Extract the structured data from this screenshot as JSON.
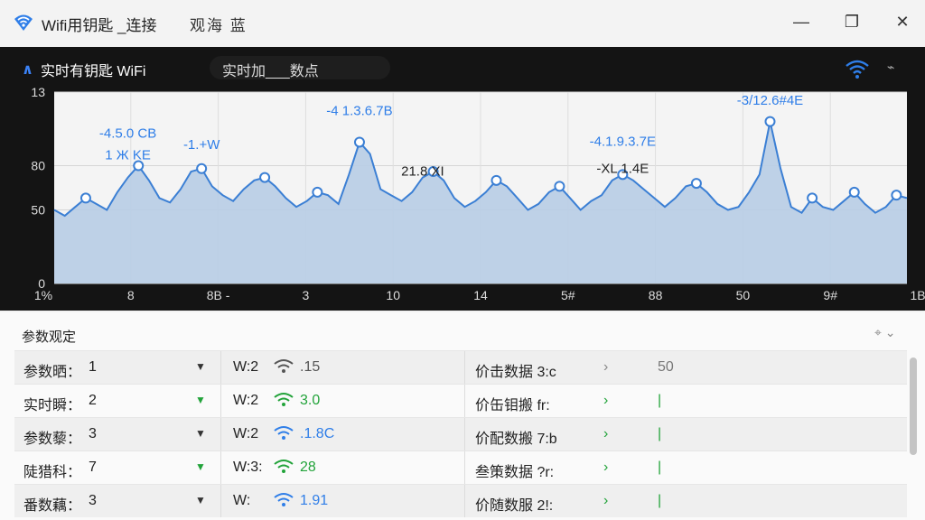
{
  "window": {
    "title": "Wifi用钥匙 _连接",
    "subtitle": "观海 蓝",
    "min_label": "—",
    "max_label": "❐",
    "close_label": "✕"
  },
  "chart_header": {
    "title": "实时有钥匙  WiFi",
    "search_text": "实时加___数点",
    "accent": "#2f7ee8"
  },
  "chart_data": {
    "type": "area",
    "ylim": [
      0,
      130
    ],
    "y_ticks": [
      "0",
      "50",
      "80",
      "13"
    ],
    "x_ticks": [
      "1%",
      "8",
      "8B -",
      "3",
      "10",
      "14",
      "5#",
      "88",
      "50",
      "9#",
      "1B"
    ],
    "series": [
      {
        "values": [
          50,
          46,
          52,
          58,
          54,
          50,
          62,
          72,
          80,
          70,
          58,
          55,
          64,
          76,
          78,
          66,
          60,
          56,
          64,
          70,
          72,
          66,
          58,
          52,
          56,
          62,
          60,
          54,
          74,
          96,
          88,
          64,
          60,
          56,
          62,
          72,
          76,
          70,
          58,
          52,
          56,
          62,
          70,
          66,
          58,
          50,
          54,
          62,
          66,
          58,
          50,
          56,
          60,
          70,
          74,
          70,
          64,
          58,
          52,
          58,
          66,
          68,
          62,
          54,
          50,
          52,
          62,
          74,
          110,
          78,
          52,
          48,
          58,
          52,
          50,
          56,
          62,
          54,
          48,
          52,
          60,
          58
        ]
      }
    ],
    "annotations": [
      {
        "text": "-4.5.0 CB",
        "color": "#2f7ee8"
      },
      {
        "text": "1 Ж KE",
        "color": "#2f7ee8"
      },
      {
        "text": "-1.+W",
        "color": "#2f7ee8"
      },
      {
        "text": "-4 1.3.6.7B",
        "color": "#2f7ee8"
      },
      {
        "text": "21.8 XI",
        "color": "#222222"
      },
      {
        "text": "-4.1.9.3.7E",
        "color": "#2f7ee8"
      },
      {
        "text": "-XL 1.4E",
        "color": "#222222"
      },
      {
        "text": "-3/12.6#4E",
        "color": "#2f7ee8"
      }
    ],
    "line_color": "#3b7fd4",
    "fill_color": "#b8cde6",
    "plot_bg": "#f4f4f4"
  },
  "params": {
    "title": "参数观定",
    "loc_label": "⌖ ⌄",
    "rows": [
      {
        "name": "参数晒：",
        "val": "1",
        "w": "W:2",
        "wval": ".15",
        "wcolor": "#555555",
        "stat": "价击数据 3:c",
        "arrow": "›",
        "sv": "50",
        "svcolor": "#777777"
      },
      {
        "name": "实时瞬：",
        "val": "2",
        "w": "W:2",
        "wval": "3.0",
        "wcolor": "#22a33a",
        "stat": "价缶钼搬 fr:",
        "arrow": "›",
        "sv": "|",
        "svcolor": "#22a33a"
      },
      {
        "name": "参数藜：",
        "val": "3",
        "w": "W:2",
        "wval": ".1.8C",
        "wcolor": "#2f7ee8",
        "stat": "价配数搬 7:b",
        "arrow": "›",
        "sv": "|",
        "svcolor": "#22a33a"
      },
      {
        "name": "陡猎科：",
        "val": "7",
        "w": "W:3:",
        "wval": "28",
        "wcolor": "#22a33a",
        "stat": "叁策数据 ?r:",
        "arrow": "›",
        "sv": "|",
        "svcolor": "#22a33a"
      },
      {
        "name": "番数藕：",
        "val": "3",
        "w": "W:",
        "wval": "1.91",
        "wcolor": "#2f7ee8",
        "stat": "价随数服 2!:",
        "arrow": "›",
        "sv": "|",
        "svcolor": "#22a33a"
      }
    ]
  }
}
